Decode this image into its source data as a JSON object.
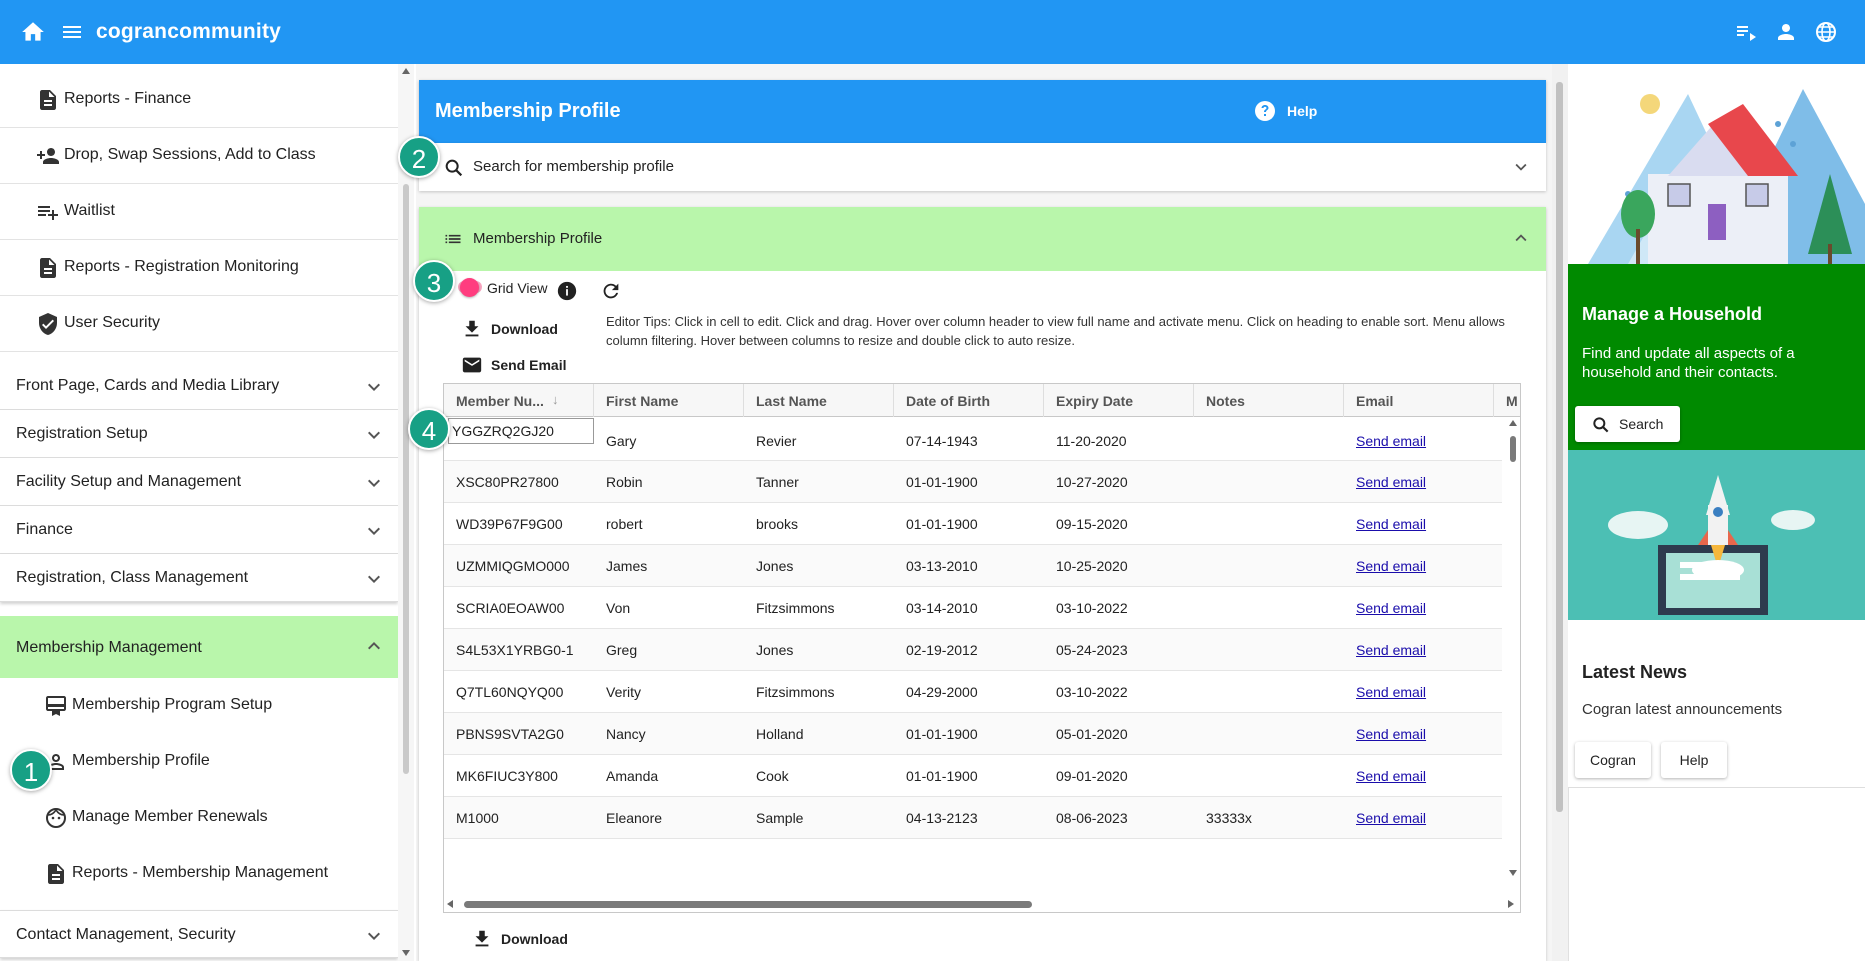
{
  "topbar": {
    "brand": "cograncommunity",
    "color": "#2196f3"
  },
  "sidebar": {
    "sub_items": [
      {
        "label": "Reports - Finance",
        "icon": "report-icon"
      },
      {
        "label": "Drop, Swap Sessions, Add to Class",
        "icon": "person-add-icon"
      },
      {
        "label": "Waitlist",
        "icon": "playlist-add-icon"
      },
      {
        "label": "Reports - Registration Monitoring",
        "icon": "report-icon"
      },
      {
        "label": "User Security",
        "icon": "shield-check-icon"
      }
    ],
    "groups": [
      {
        "label": "Front Page, Cards and Media Library"
      },
      {
        "label": "Registration Setup"
      },
      {
        "label": "Facility Setup and Management"
      },
      {
        "label": "Finance"
      },
      {
        "label": "Registration, Class Management"
      }
    ],
    "membership_management": {
      "label": "Membership Management",
      "items": [
        {
          "label": "Membership Program Setup",
          "icon": "card-membership-icon"
        },
        {
          "label": "Membership Profile",
          "icon": "person-outline-icon"
        },
        {
          "label": "Manage Member Renewals",
          "icon": "face-icon"
        },
        {
          "label": "Reports - Membership Management",
          "icon": "report-icon"
        }
      ]
    },
    "bottom_group": {
      "label": "Contact Management, Security"
    }
  },
  "badges": [
    "1",
    "2",
    "3",
    "4"
  ],
  "main": {
    "title": "Membership Profile",
    "help_label": "Help",
    "search_label": "Search for membership profile",
    "list_title": "Membership Profile",
    "grid_view_label": "Grid View",
    "download_label": "Download",
    "send_email_label": "Send Email",
    "editor_tips": "Editor Tips: Click in cell to edit. Click and drag. Hover over column header to view full name and activate menu. Click on heading to enable sort. Menu allows column filtering. Hover between columns to resize and double click to auto resize.",
    "bottom_download_label": "Download"
  },
  "grid": {
    "columns": [
      "Member Nu...",
      "First Name",
      "Last Name",
      "Date of Birth",
      "Expiry Date",
      "Notes",
      "Email",
      "M"
    ],
    "editing_value": "YGGZRQ2GJ20",
    "rows": [
      {
        "member": "",
        "first": "Gary",
        "last": "Revier",
        "dob": "07-14-1943",
        "expiry": "11-20-2020",
        "notes": "",
        "email": "Send email"
      },
      {
        "member": "XSC80PR27800",
        "first": "Robin",
        "last": "Tanner",
        "dob": "01-01-1900",
        "expiry": "10-27-2020",
        "notes": "",
        "email": "Send email"
      },
      {
        "member": "WD39P67F9G00",
        "first": "robert",
        "last": "brooks",
        "dob": "01-01-1900",
        "expiry": "09-15-2020",
        "notes": "",
        "email": "Send email"
      },
      {
        "member": "UZMMIQGMO000",
        "first": "James",
        "last": "Jones",
        "dob": "03-13-2010",
        "expiry": "10-25-2020",
        "notes": "",
        "email": "Send email"
      },
      {
        "member": "SCRIA0EOAW00",
        "first": "Von",
        "last": "Fitzsimmons",
        "dob": "03-14-2010",
        "expiry": "03-10-2022",
        "notes": "",
        "email": "Send email"
      },
      {
        "member": "S4L53X1YRBG0-1",
        "first": "Greg",
        "last": "Jones",
        "dob": "02-19-2012",
        "expiry": "05-24-2023",
        "notes": "",
        "email": "Send email"
      },
      {
        "member": "Q7TL60NQYQ00",
        "first": "Verity",
        "last": "Fitzsimmons",
        "dob": "04-29-2000",
        "expiry": "03-10-2022",
        "notes": "",
        "email": "Send email"
      },
      {
        "member": "PBNS9SVTA2G0",
        "first": "Nancy",
        "last": "Holland",
        "dob": "01-01-1900",
        "expiry": "05-01-2020",
        "notes": "",
        "email": "Send email"
      },
      {
        "member": "MK6FIUC3Y800",
        "first": "Amanda",
        "last": "Cook",
        "dob": "01-01-1900",
        "expiry": "09-01-2020",
        "notes": "",
        "email": "Send email"
      },
      {
        "member": "M1000",
        "first": "Eleanore",
        "last": "Sample",
        "dob": "04-13-2123",
        "expiry": "08-06-2023",
        "notes": "33333x",
        "email": "Send email"
      }
    ]
  },
  "right": {
    "household_title": "Manage a Household",
    "household_desc": "Find and update all aspects of a household and their contacts.",
    "household_button": "Search",
    "news_title": "Latest News",
    "news_sub": "Cogran latest announcements",
    "news_buttons": [
      "Cogran",
      "Help"
    ],
    "household_color": "#008a00",
    "highlight_color": "#b9f6ab"
  }
}
